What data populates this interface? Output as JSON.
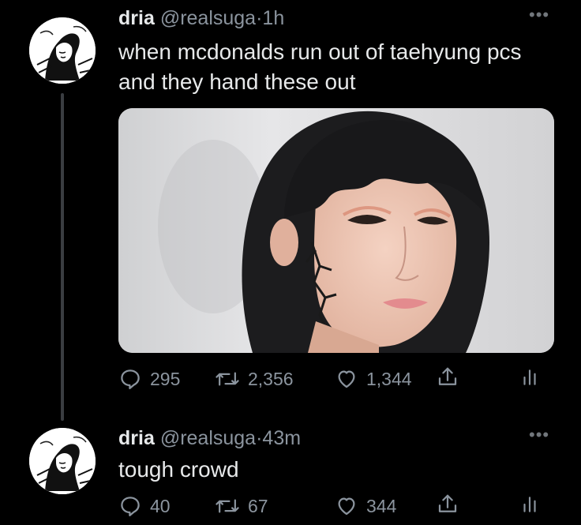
{
  "tweets": [
    {
      "display_name": "dria",
      "handle": "@realsuga",
      "separator": "·",
      "time": "1h",
      "text_lines": [
        "when mcdonalds run out of taehyung pcs",
        "and they hand these out"
      ],
      "actions": {
        "replies": "295",
        "retweets": "2,356",
        "likes": "1,344"
      }
    },
    {
      "display_name": "dria",
      "handle": "@realsuga",
      "separator": "·",
      "time": "43m",
      "text_lines": [
        "tough crowd"
      ],
      "actions": {
        "replies": "40",
        "retweets": "67",
        "likes": "344"
      }
    }
  ],
  "icons": [
    "reply-icon",
    "retweet-icon",
    "like-icon",
    "share-icon",
    "analytics-icon",
    "more-icon"
  ],
  "colors": {
    "background": "#000000",
    "text": "#e7e9ea",
    "muted": "#8b949e",
    "thread_line": "#3a3d41"
  }
}
